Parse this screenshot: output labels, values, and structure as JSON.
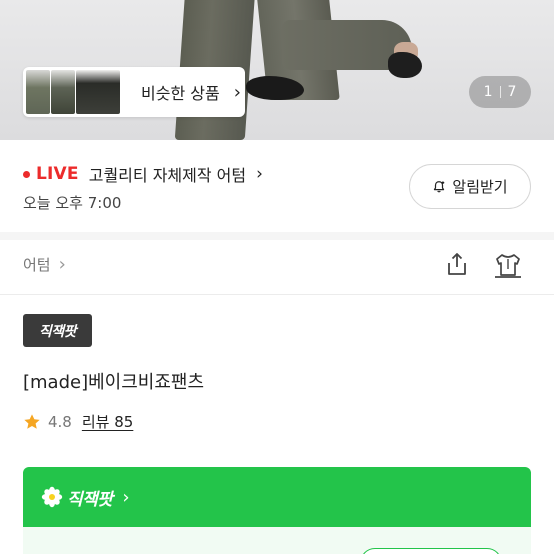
{
  "hero": {
    "similar_label": "비슷한 상품",
    "counter_current": "1",
    "counter_total": "7"
  },
  "live": {
    "badge": "LIVE",
    "title": "고퀄리티 자체제작 어텀",
    "time": "오늘 오후 7:00",
    "alert_label": "알림받기"
  },
  "store": {
    "name": "어텀"
  },
  "product": {
    "brand_badge": "직잭팟",
    "name": "[made]베이크비죠팬츠",
    "rating": "4.8",
    "review_label": "리뷰 85"
  },
  "banner": {
    "label": "직잭팟"
  },
  "colors": {
    "live_red": "#ec2b2b",
    "brand_green": "#23c44a",
    "star": "#f5a623"
  }
}
